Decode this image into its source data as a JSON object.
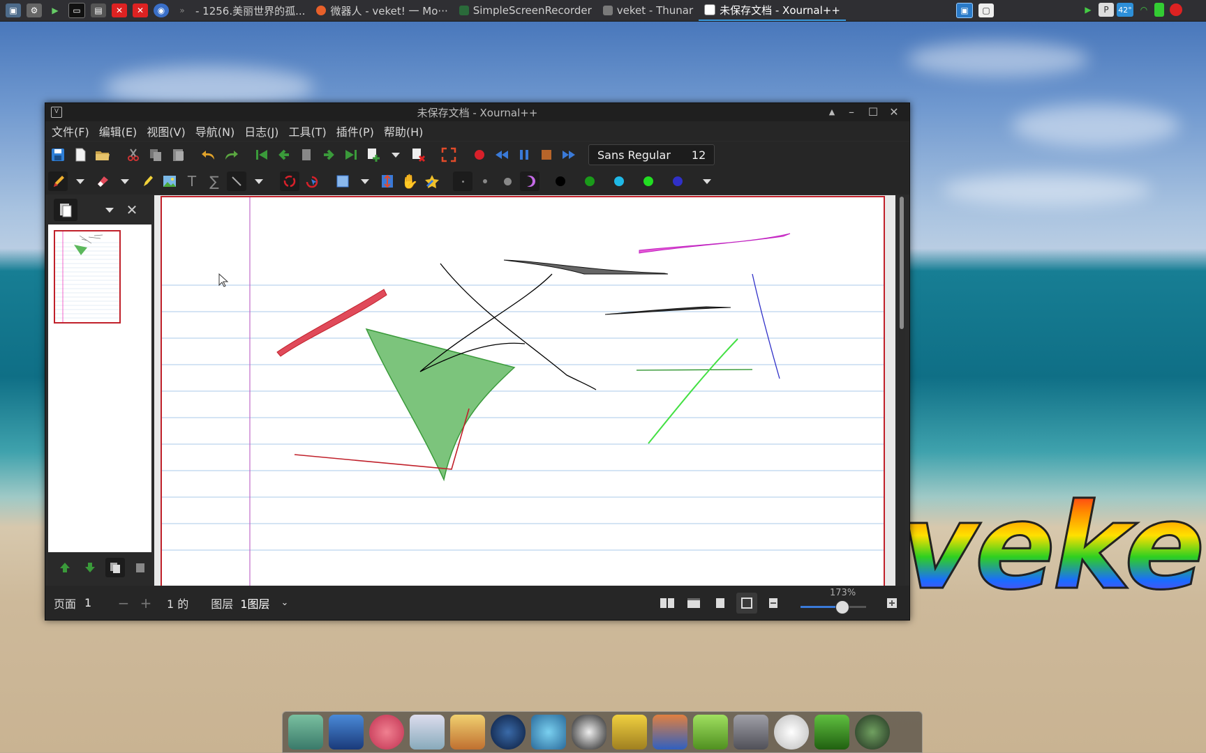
{
  "taskbar": {
    "tasks": [
      {
        "label": "- 1256.美丽世界的孤...",
        "active": false
      },
      {
        "label": "微器人 - veket! 一 Mo···",
        "active": false
      },
      {
        "label": "SimpleScreenRecorder",
        "active": false
      },
      {
        "label": "veket - Thunar",
        "active": false
      },
      {
        "label": "未保存文档 - Xournal++",
        "active": true
      }
    ],
    "tray_temp": "42°"
  },
  "window": {
    "title": "未保存文档 - Xournal++",
    "menu": [
      "文件(F)",
      "编辑(E)",
      "视图(V)",
      "导航(N)",
      "日志(J)",
      "工具(T)",
      "插件(P)",
      "帮助(H)"
    ],
    "font_name": "Sans Regular",
    "font_size": "12",
    "colors": [
      "#000000",
      "#1a9a1a",
      "#1fb8e6",
      "#22dd22",
      "#3030c8"
    ]
  },
  "statusbar": {
    "page_label": "页面",
    "page_value": "1",
    "of_label": "1 的",
    "layer_label": "图层",
    "layer_value": "1图层",
    "zoom": "173%"
  },
  "desktop": {
    "logo_text": "veket"
  }
}
